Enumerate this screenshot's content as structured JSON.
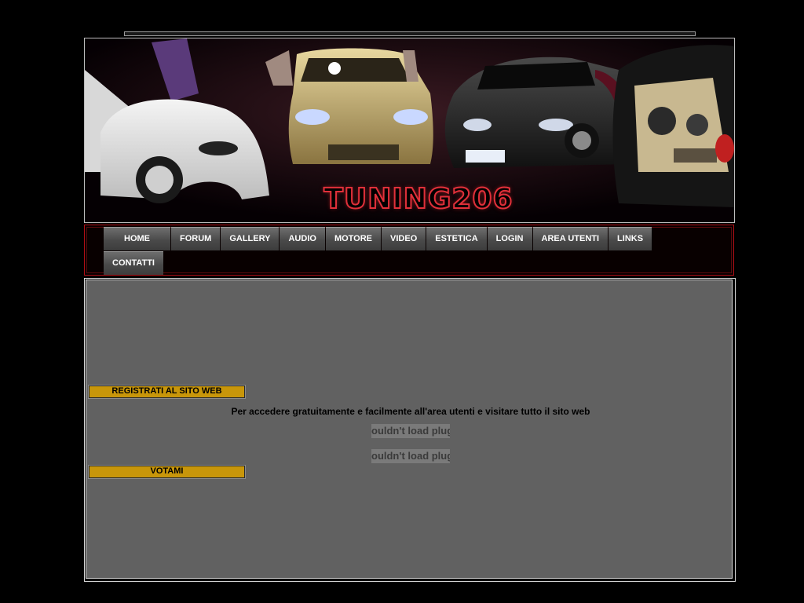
{
  "banner": {
    "title": "TUNING206"
  },
  "nav": {
    "items": [
      {
        "label": "HOME"
      },
      {
        "label": "FORUM"
      },
      {
        "label": "GALLERY"
      },
      {
        "label": "AUDIO"
      },
      {
        "label": "MOTORE"
      },
      {
        "label": "VIDEO"
      },
      {
        "label": "ESTETICA"
      },
      {
        "label": "LOGIN"
      },
      {
        "label": "AREA UTENTI"
      },
      {
        "label": "LINKS"
      },
      {
        "label": "CONTATTI"
      }
    ]
  },
  "sections": {
    "register": {
      "header": "REGISTRATI AL SITO WEB",
      "text": "Per accedere gratuitamente e facilmente all'area utenti e visitare tutto il sito web"
    },
    "plugins": [
      "ouldn't load plug",
      "ouldn't load plug"
    ],
    "vote": {
      "header": "VOTAMI"
    }
  },
  "colors": {
    "background": "#000000",
    "content_bg": "#616161",
    "header_accent": "#c8960a",
    "nav_border": "#b10e16"
  }
}
